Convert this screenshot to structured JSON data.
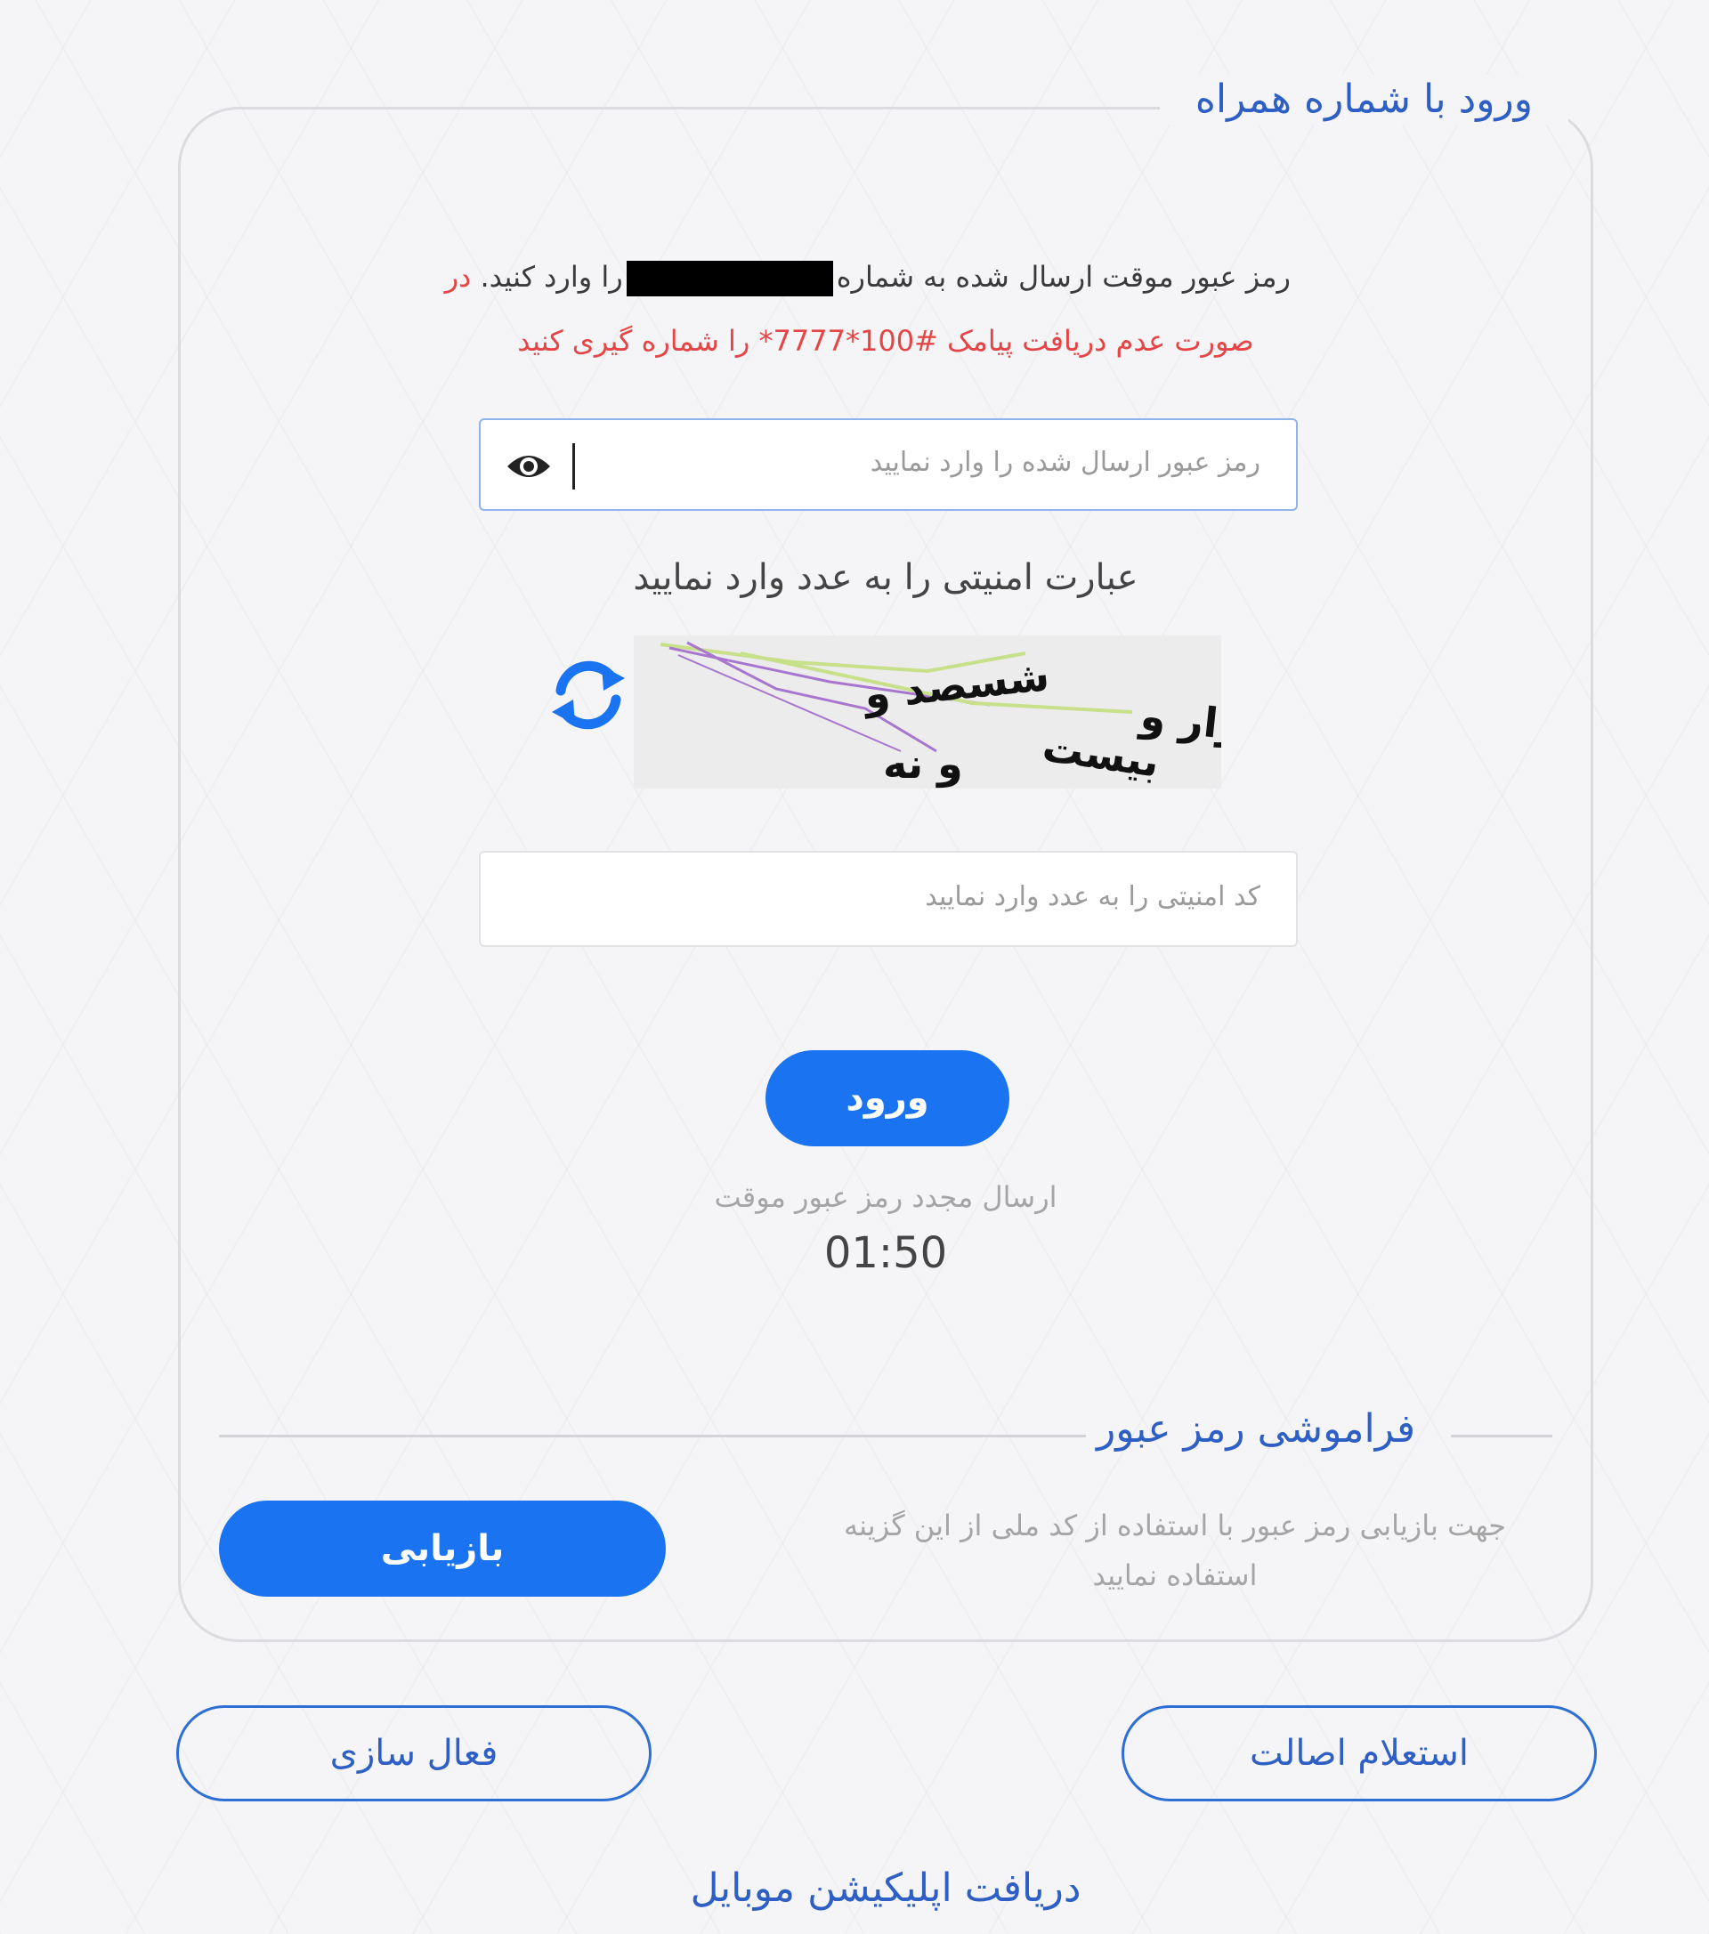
{
  "login_card": {
    "title": "ورود با شماره همراه",
    "info_part1": "رمز عبور موقت ارسال شده به شماره",
    "info_part2": "را وارد کنید.",
    "info_part3": "در",
    "info_line2": "صورت عدم دریافت پیامک #100*7777* را شماره گیری کنید",
    "password_placeholder": "رمز عبور ارسال شده را وارد نمایید",
    "captcha_label": "عبارت امنیتی را به عدد وارد نمایید",
    "captcha_text": {
      "line1": "نه هزار و",
      "line2": "شسصد و",
      "line3": "بیست",
      "line4": "و نه"
    },
    "code_placeholder": "کد امنیتی را به عدد وارد نمایید",
    "login_button": "ورود",
    "resend_label": "ارسال مجدد رمز عبور موقت",
    "timer": "01:50"
  },
  "forgot": {
    "title": "فراموشی رمز عبور",
    "description": "جهت بازیابی رمز عبور با استفاده از کد ملی از این گزینه استفاده نمایید",
    "recover_button": "بازیابی"
  },
  "footer": {
    "authenticity_button": "استعلام اصالت",
    "activation_button": "فعال سازی",
    "download_app": "دریافت اپلیکیشن موبایل"
  },
  "colors": {
    "accent": "#1a73f0",
    "title_blue": "#2e5fc5",
    "warning_red": "#e64545"
  },
  "icons": {
    "show_password": "eye-icon",
    "refresh_captcha": "refresh-icon"
  }
}
